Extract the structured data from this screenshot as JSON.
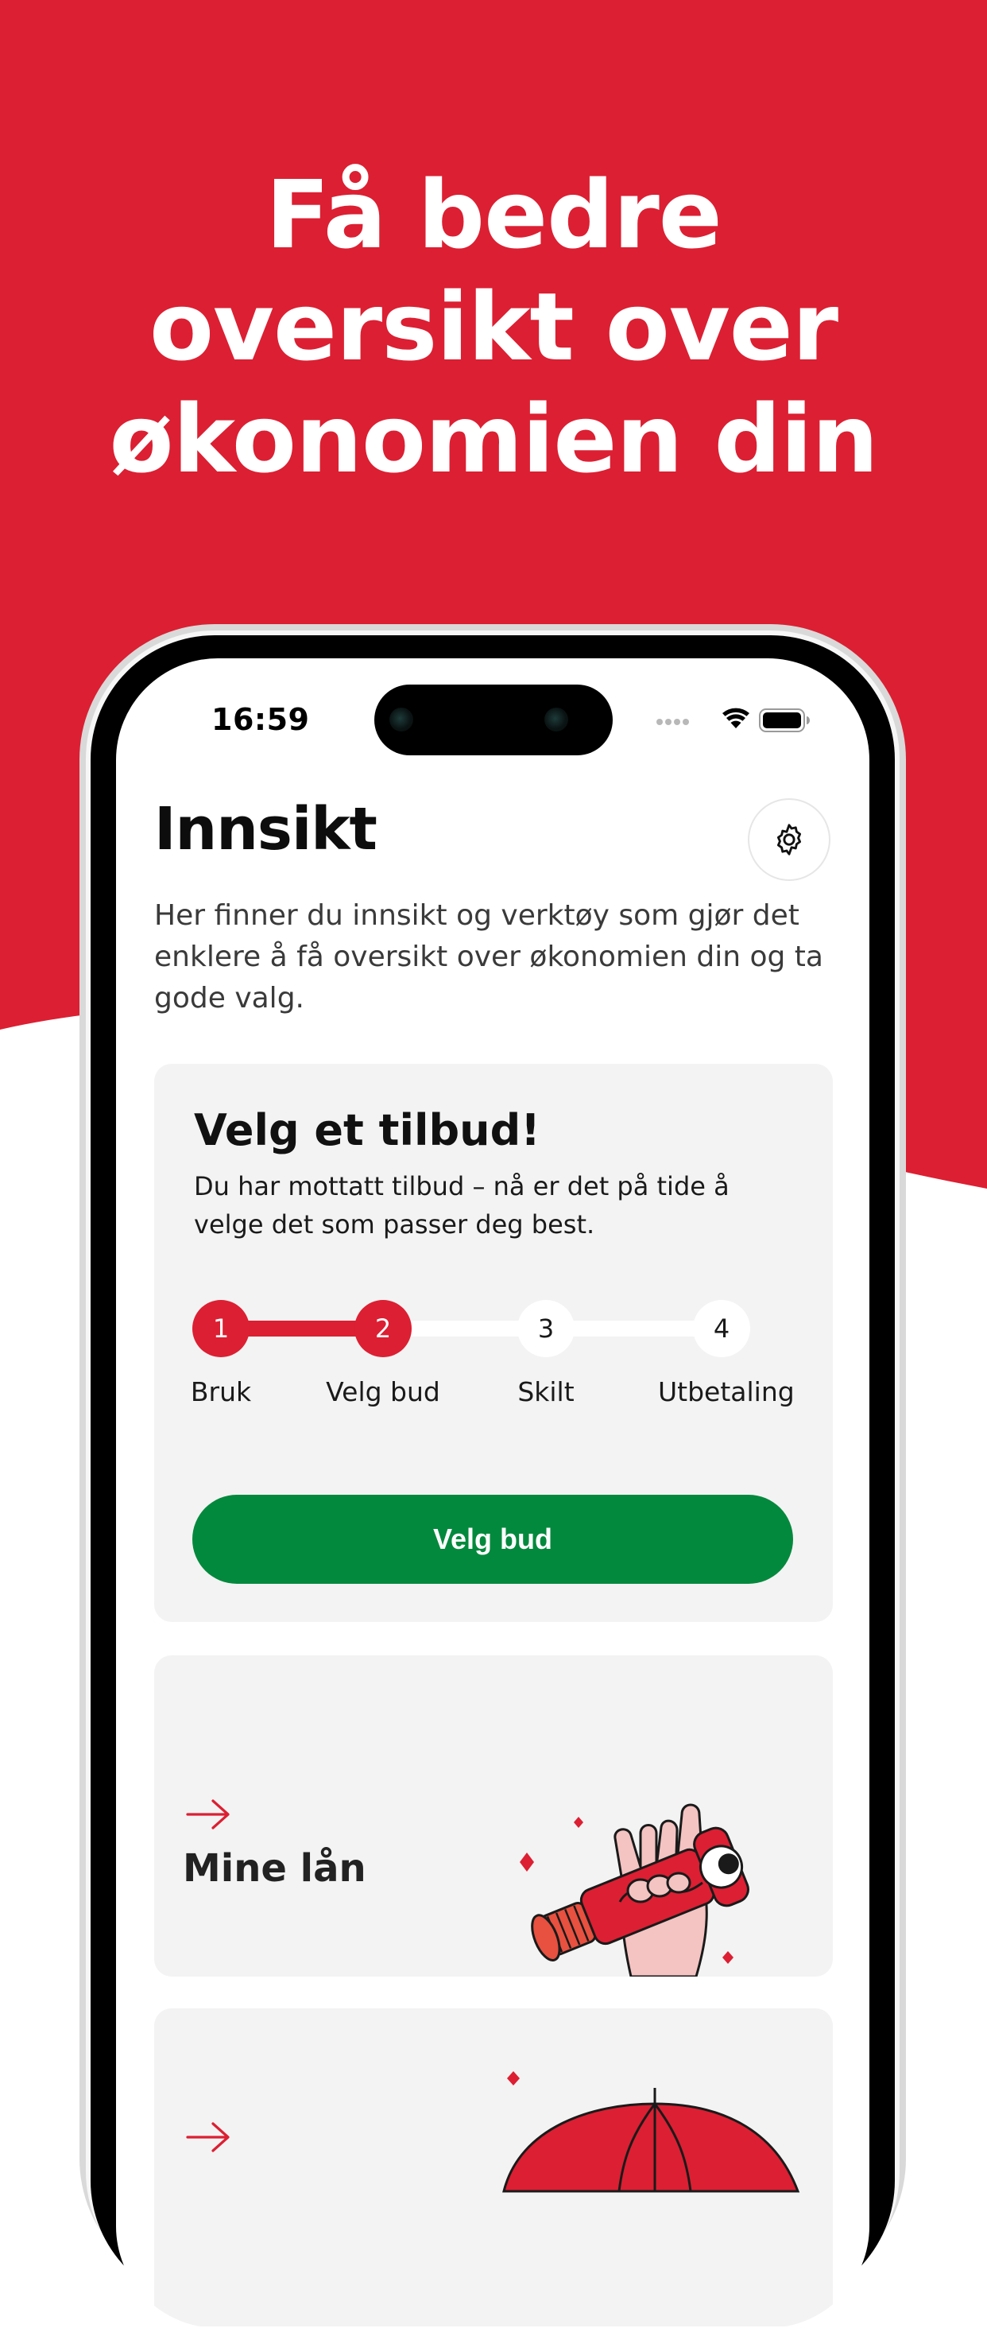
{
  "promo": {
    "headline_lines": [
      "Få bedre",
      "oversikt over",
      "økonomien din"
    ],
    "brand_color": "#dc1f32"
  },
  "status_bar": {
    "time": "16:59",
    "icons": [
      "signal-dots-icon",
      "wifi-icon",
      "battery-icon"
    ]
  },
  "screen": {
    "title": "Innsikt",
    "settings_icon": "gear-icon",
    "intro": "Her finner du innsikt og verktøy som gjør det enklere å få oversikt over økonomien din og ta gode valg."
  },
  "offer_card": {
    "title": "Velg et tilbud!",
    "description": "Du har mottatt tilbud – nå er det på tide å velge det som passer deg best.",
    "steps": [
      {
        "number": "1",
        "label": "Bruk",
        "completed": true
      },
      {
        "number": "2",
        "label": "Velg bud",
        "completed": true
      },
      {
        "number": "3",
        "label": "Skilt",
        "completed": false
      },
      {
        "number": "4",
        "label": "Utbetaling",
        "completed": false
      }
    ],
    "progress_fraction": 0.5,
    "button_label": "Velg bud",
    "button_color": "#03893d"
  },
  "loans_card": {
    "label": "Mine lån",
    "arrow_icon": "arrow-right-icon",
    "illustration": "hand-holding-telescope-illustration"
  },
  "third_card": {
    "arrow_icon": "arrow-right-icon",
    "illustration": "umbrella-illustration"
  }
}
